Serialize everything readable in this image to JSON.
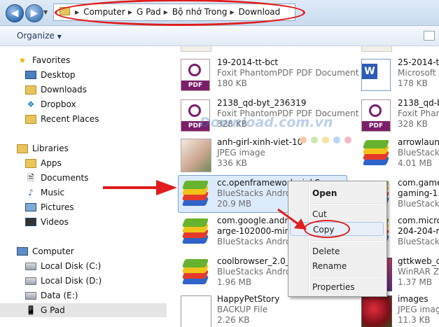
{
  "address": {
    "crumbs": [
      "Computer",
      "G Pad",
      "Bộ nhớ Trong",
      "Download"
    ]
  },
  "toolbar": {
    "organize_label": "Organize"
  },
  "nav": {
    "favorites_label": "Favorites",
    "favorites": [
      "Desktop",
      "Downloads",
      "Dropbox",
      "Recent Places"
    ],
    "libraries_label": "Libraries",
    "libraries": [
      "Apps",
      "Documents",
      "Music",
      "Pictures",
      "Videos"
    ],
    "computer_label": "Computer",
    "computer": [
      "Local Disk (C:)",
      "Local Disk (D:)",
      "Data (E:)",
      "G Pad"
    ]
  },
  "files_left": [
    {
      "name": "",
      "type": "",
      "size": ""
    },
    {
      "name": "19-2014-tt-bct",
      "type": "Foxit PhantomPDF PDF Document",
      "size": "180 KB"
    },
    {
      "name": "2138_qd-byt_236319",
      "type": "Foxit PhantomPDF PDF Document",
      "size": "328 KB"
    },
    {
      "name": "anh-girl-xinh-viet-10-",
      "type": "JPEG image",
      "size": "336 KB"
    },
    {
      "name": "cc.openframeworks.inkSpace",
      "type": "BlueStacks Android",
      "size": "20.9 MB"
    },
    {
      "name": "com.google.android",
      "name2": "arge-102000-minAl",
      "type": "BlueStacks Andro",
      "size": ""
    },
    {
      "name": "coolbrowser_2.0_re",
      "type": "BlueStacks Andro",
      "size": "1.96 MB"
    },
    {
      "name": "HappyPetStory",
      "type": "BACKUP File",
      "size": "2.26 KB"
    }
  ],
  "files_right": [
    {
      "name": "",
      "type": "",
      "size": ""
    },
    {
      "name": "25-2014-tt-",
      "type": "Microsoft W",
      "size": "178 KB"
    },
    {
      "name": "2138_qd-by",
      "type": "Foxit Phan",
      "size": "328 KB"
    },
    {
      "name": "arrowlaunch",
      "type": "BlueStacks A",
      "size": "4.01 MB"
    },
    {
      "name": "com.gamelo",
      "name2": "gaming-1.0.",
      "size": "BlueStacks A",
      "type": ""
    },
    {
      "name": "com.micros",
      "name2": "204-204-min",
      "size": "BlueStacks A",
      "type": ""
    },
    {
      "name": "gttkweb_do",
      "type": "WinRAR ZIP",
      "size": "1.37 MB"
    },
    {
      "name": "images",
      "type": "JPEG image",
      "size": "11.3 KB"
    }
  ],
  "watermark": "Download.com.vn",
  "context_menu": {
    "items": [
      "Open",
      "Cut",
      "Copy",
      "Delete",
      "Rename",
      "Properties"
    ]
  },
  "icon_labels": {
    "pdf": "PDF",
    "word": "W"
  },
  "colors": {
    "annotation_red": "#e11d1d",
    "selection": "#dcebfc",
    "pdf_band": "#7b1f6a"
  }
}
